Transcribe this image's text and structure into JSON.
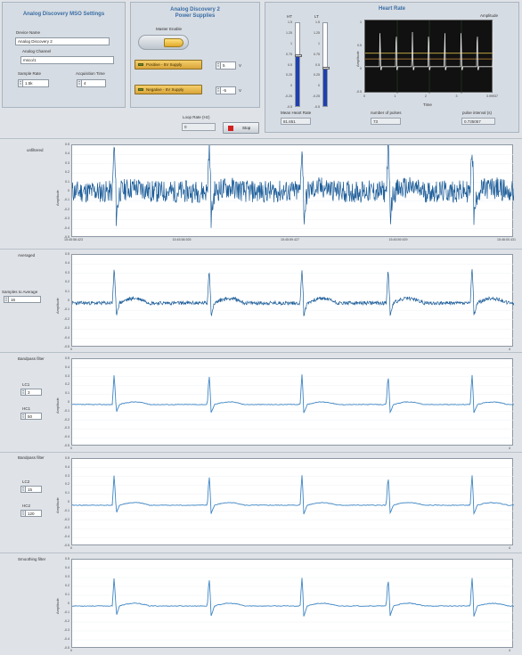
{
  "msoSettings": {
    "title": "Analog Discovery MSO Settings",
    "deviceNameLabel": "Device Name",
    "deviceName": "Analog Discovery 2",
    "analogChannelLabel": "Analog Channel",
    "analogChannel": "msco/1",
    "sampleRateLabel": "Sample Rate",
    "sampleRate": "1.5k",
    "acquisitionTimeLabel": "Acquisition Time",
    "acquisitionTime": "4"
  },
  "powerSupplies": {
    "title_line1": "Analog Discovery 2",
    "title_line2": "Power Supplies",
    "masterEnableLabel": "Master Enable",
    "positiveLabel": "Positive - 5V Supply",
    "positiveValue": "5",
    "positiveUnit": "V",
    "negativeLabel": "Negative - 5V Supply",
    "negativeValue": "-5",
    "negativeUnit": "V"
  },
  "loop": {
    "rateLabel": "Loop Rate (Hz)",
    "rateValue": "0",
    "stopLabel": "Stop"
  },
  "heartRate": {
    "title": "Heart Rate",
    "htLabel": "HT",
    "ltLabel": "LT",
    "htTicks": [
      "1.5",
      "1.25",
      "1",
      "0.75",
      "0.5",
      "0.25",
      "0",
      "-0.25",
      "-0.5"
    ],
    "ltTicks": [
      "1.5",
      "1.25",
      "1",
      "0.75",
      "0.5",
      "0.25",
      "0",
      "-0.25",
      "-0.5"
    ],
    "ht": 0.7,
    "lt": 0.4,
    "graphLegend": "Amplitude",
    "graphYLabel": "Amplitude",
    "graphXLabel": "Time",
    "graphYTicks": [
      "1",
      "0.5",
      "0",
      "-0.5"
    ],
    "graphXTicks": [
      "0",
      "1",
      "2",
      "3",
      "3.99937"
    ],
    "meanLabel": "Mean Heart Rate",
    "meanValue": "81.651",
    "pulsesLabel": "number of pulses",
    "pulsesValue": "73",
    "intervalLabel": "pulse interval (s)",
    "intervalValue": "0.735057"
  },
  "plots": {
    "unfiltered": {
      "title": "unfiltered",
      "yLabel": "Amplitude",
      "yTicks": [
        "0.5",
        "0.4",
        "0.3",
        "0.2",
        "0.1",
        "0",
        "-0.1",
        "-0.2",
        "-0.3",
        "-0.4",
        "-0.5"
      ],
      "xTicks": [
        "15:45:58.423",
        "15:45:58.925",
        "15:45:59.427",
        "15:45:59.929",
        "15:46:00.431"
      ]
    },
    "averaged": {
      "title": "Averaged",
      "samplesLabel": "Samples to Average",
      "samplesValue": "16",
      "yLabel": "Amplitude",
      "yTicks": [
        "0.5",
        "0.4",
        "0.3",
        "0.2",
        "0.1",
        "0",
        "-0.1",
        "-0.2",
        "-0.3",
        "-0.4",
        "-0.5"
      ],
      "xTicks": [
        "0",
        "4"
      ]
    },
    "bandpass1": {
      "title": "Bandpass filter",
      "lcLabel": "LC1",
      "lcValue": "3",
      "hcLabel": "HC1",
      "hcValue": "50",
      "yLabel": "Amplitude",
      "yTicks": [
        "0.5",
        "0.4",
        "0.3",
        "0.2",
        "0.1",
        "0",
        "-0.1",
        "-0.2",
        "-0.3",
        "-0.4",
        "-0.5"
      ],
      "xTicks": [
        "0",
        "4"
      ]
    },
    "bandpass2": {
      "title": "Bandpass filter",
      "lcLabel": "LC2",
      "lcValue": "15",
      "hcLabel": "HC2",
      "hcValue": "120",
      "yLabel": "Amplitude",
      "yTicks": [
        "0.5",
        "0.4",
        "0.3",
        "0.2",
        "0.1",
        "0",
        "-0.1",
        "-0.2",
        "-0.3",
        "-0.4",
        "-0.5"
      ],
      "xTicks": [
        "0",
        "4"
      ]
    },
    "smoothing": {
      "title": "Smoothing filter",
      "yLabel": "Amplitude",
      "yTicks": [
        "0.5",
        "0.4",
        "0.3",
        "0.2",
        "0.1",
        "0",
        "-0.1",
        "-0.2",
        "-0.3",
        "-0.4",
        "-0.5"
      ],
      "xTicks": [
        "0",
        "4"
      ]
    }
  },
  "colors": {
    "trace": "#1f5f9a",
    "traceLight": "#3f86c4",
    "accent": "#3a6ea5",
    "stop": "#d22020"
  }
}
